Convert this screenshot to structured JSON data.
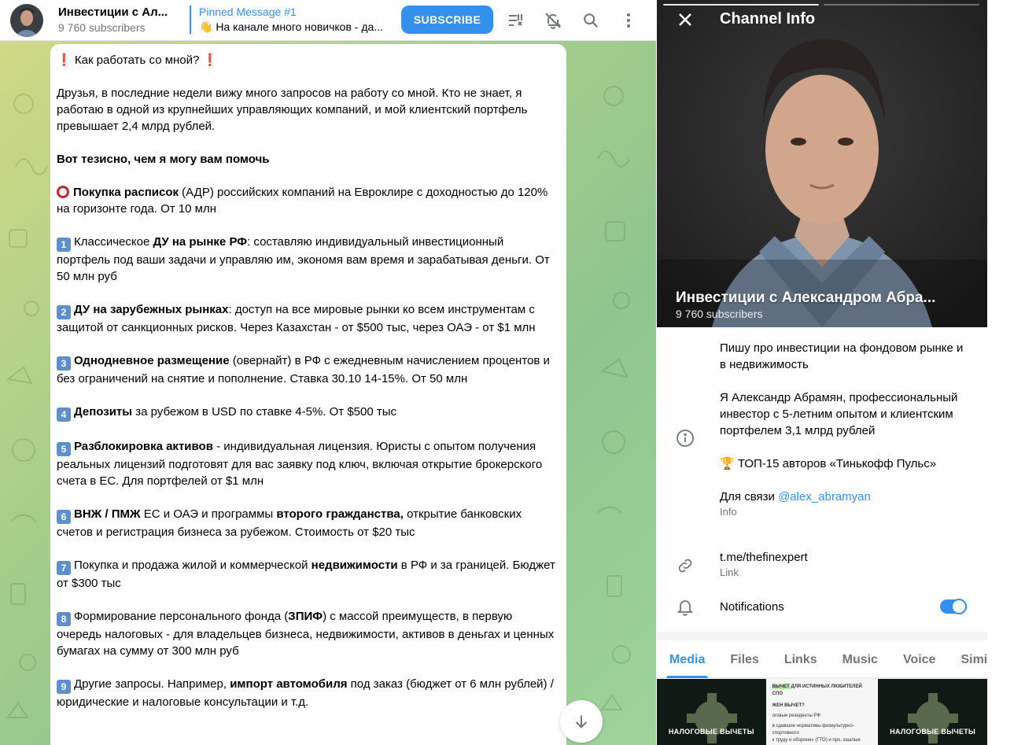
{
  "header": {
    "title": "Инвестиции с Ал...",
    "subscribers": "9 760 subscribers",
    "pinned_title": "Pinned Message #1",
    "pinned_text": "👋 На канале много новичков - да...",
    "subscribe_label": "SUBSCRIBE",
    "icons": [
      "channel-settings-icon",
      "mute-icon",
      "search-icon",
      "more-icon"
    ]
  },
  "message": {
    "heading": "Как работать со мной?",
    "intro": "Друзья, в последние недели вижу много запросов на работу со мной. Кто не знает, я работаю в одной из крупнейших управляющих компаний, и мой клиентский портфель превышает 2,4 млрд рублей.",
    "subheading": "Вот тезисно, чем я могу вам помочь",
    "item0_bold": "Покупка расписок",
    "item0_text": " (АДР) российских компаний на Евроклире с доходностью до 120% на горизонте года. От 10 млн",
    "item1_num": "1",
    "item1_pre": "Классическое ",
    "item1_bold": "ДУ на рынке РФ",
    "item1_text": ": составляю индивидуальный инвестиционный портфель под ваши задачи и управляю им, экономя вам время и зарабатывая деньги. От 50 млн руб",
    "item2_num": "2",
    "item2_bold": "ДУ на зарубежных рынках",
    "item2_text": ": доступ на все мировые рынки ко всем инструментам с защитой от санкционных рисков. Через Казахстан - от $500 тыс, через ОАЭ - от $1 млн",
    "item3_num": "3",
    "item3_bold": "Однодневное размещение",
    "item3_text": " (овернайт) в РФ с ежедневным начислением процентов и без ограничений на снятие и пополнение. Ставка 30.10 14-15%. От 50 млн",
    "item4_num": "4",
    "item4_bold": "Депозиты",
    "item4_text": " за рубежом в USD по ставке 4-5%. От $500 тыс",
    "item5_num": "5",
    "item5_bold": "Разблокировка активов",
    "item5_text": " - индивидуальная лицензия. Юристы с опытом получения реальных лицензий подготовят для вас заявку под ключ, включая открытие брокерского счета в ЕС. Для портфелей от $1 млн",
    "item6_num": "6",
    "item6_bold": "ВНЖ / ПМЖ",
    "item6_text1": " ЕС и ОАЭ и программы ",
    "item6_bold2": "второго гражданства,",
    "item6_text2": " открытие банковских счетов и регистрация бизнеса за рубежом. Стоимость от $20 тыс",
    "item7_num": "7",
    "item7_pre": "Покупка и продажа жилой и коммерческой ",
    "item7_bold": "недвижимости",
    "item7_text": " в РФ и за границей. Бюджет от $300 тыс",
    "item8_num": "8",
    "item8_pre": "Формирование персонального фонда (",
    "item8_bold": "ЗПИФ",
    "item8_text": ") с массой преимуществ, в первую очередь налоговых - для владельцев бизнеса,  недвижимости, активов в деньгах и ценных бумагах на сумму от 300 млн руб",
    "item9_num": "9",
    "item9_pre": "Другие запросы. Например, ",
    "item9_bold": "импорт автомобиля",
    "item9_text": " под заказ (бюджет от 6 млн рублей) / юридические и налоговые консультации и т.д."
  },
  "info": {
    "title": "Channel Info",
    "channel_name": "Инвестиции с Александром Абра...",
    "subscribers": "9 760 subscribers",
    "desc1": "Пишу про инвестиции на фондовом рынке и в недвижимость",
    "desc2": "Я Александр Абрамян, профессиональный инвестор с 5-летним опытом и клиентским портфелем 3,1 млрд  рублей",
    "desc3": "🏆 ТОП-15 авторов «Тинькофф Пульс»",
    "contact_pre": "Для связи ",
    "contact_handle": "@alex_abramyan",
    "info_label": "Info",
    "link": "t.me/thefinexpert",
    "link_label": "Link",
    "notifications": "Notifications",
    "notifications_on": true
  },
  "tabs": [
    "Media",
    "Files",
    "Links",
    "Music",
    "Voice",
    "Simila"
  ],
  "media": {
    "tile1_caption": "НАЛОГОВЫЕ ВЫЧЕТЫ",
    "tile2_line1_hl": "ВЫЧЕТ",
    "tile2_line1": " ДЛЯ ИСТИННЫХ ЛЮБИТЕЛЕЙ СПО",
    "tile2_line2": "ЖЕН ВЫЧЕТ?",
    "tile2_line3": "оговые резиденты РФ",
    "tile2_line4": "в сдавшие нормативы физкультурно-спортивного",
    "tile2_line5": "к труду и обороне» (ГТО) и про. зашлые дисплен",
    "tile3_caption": "НАЛОГОВЫЕ ВЫЧЕТЫ"
  },
  "colors": {
    "accent": "#3390ec",
    "number_badge": "#5e8fcc",
    "red_mark": "#d0202a"
  }
}
